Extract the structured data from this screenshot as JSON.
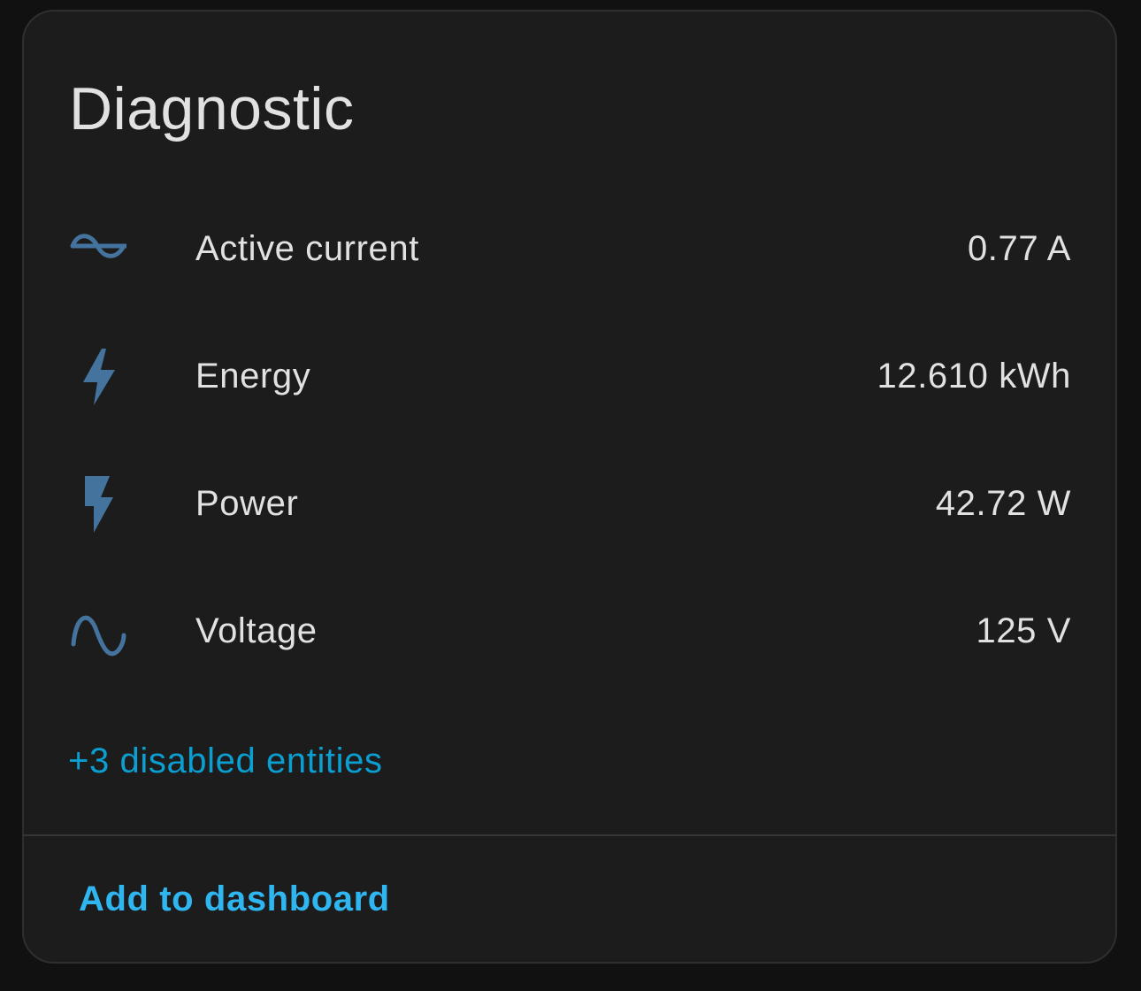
{
  "card": {
    "title": "Diagnostic"
  },
  "entities": [
    {
      "icon": "current-ac-icon",
      "name": "Active current",
      "value": "0.77 A"
    },
    {
      "icon": "lightning-bolt-icon",
      "name": "Energy",
      "value": "12.610 kWh"
    },
    {
      "icon": "flash-icon",
      "name": "Power",
      "value": "42.72 W"
    },
    {
      "icon": "sine-wave-icon",
      "name": "Voltage",
      "value": "125 V"
    }
  ],
  "disabled_link": "+3 disabled entities",
  "actions": {
    "add_to_dashboard": "Add to dashboard"
  },
  "colors": {
    "background": "#111111",
    "card": "#1c1c1c",
    "text": "#e1e1e1",
    "icon": "#44739e",
    "link": "#0a9fd0",
    "button": "#2fb6f0"
  }
}
